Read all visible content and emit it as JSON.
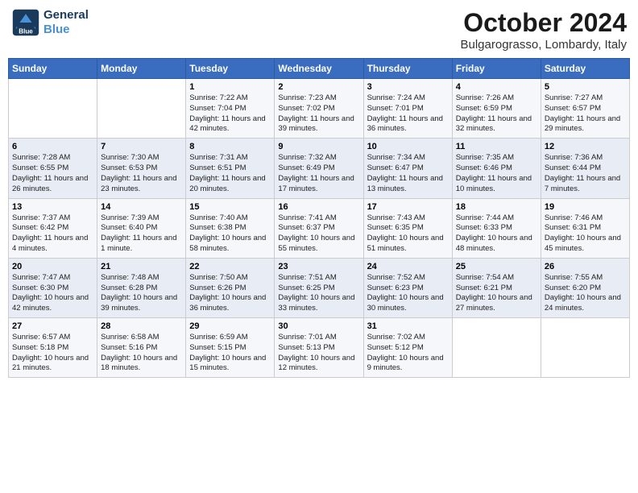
{
  "header": {
    "logo_line1": "General",
    "logo_line2": "Blue",
    "month": "October 2024",
    "location": "Bulgarograsso, Lombardy, Italy"
  },
  "weekdays": [
    "Sunday",
    "Monday",
    "Tuesday",
    "Wednesday",
    "Thursday",
    "Friday",
    "Saturday"
  ],
  "weeks": [
    [
      {
        "day": "",
        "sunrise": "",
        "sunset": "",
        "daylight": ""
      },
      {
        "day": "",
        "sunrise": "",
        "sunset": "",
        "daylight": ""
      },
      {
        "day": "1",
        "sunrise": "Sunrise: 7:22 AM",
        "sunset": "Sunset: 7:04 PM",
        "daylight": "Daylight: 11 hours and 42 minutes."
      },
      {
        "day": "2",
        "sunrise": "Sunrise: 7:23 AM",
        "sunset": "Sunset: 7:02 PM",
        "daylight": "Daylight: 11 hours and 39 minutes."
      },
      {
        "day": "3",
        "sunrise": "Sunrise: 7:24 AM",
        "sunset": "Sunset: 7:01 PM",
        "daylight": "Daylight: 11 hours and 36 minutes."
      },
      {
        "day": "4",
        "sunrise": "Sunrise: 7:26 AM",
        "sunset": "Sunset: 6:59 PM",
        "daylight": "Daylight: 11 hours and 32 minutes."
      },
      {
        "day": "5",
        "sunrise": "Sunrise: 7:27 AM",
        "sunset": "Sunset: 6:57 PM",
        "daylight": "Daylight: 11 hours and 29 minutes."
      }
    ],
    [
      {
        "day": "6",
        "sunrise": "Sunrise: 7:28 AM",
        "sunset": "Sunset: 6:55 PM",
        "daylight": "Daylight: 11 hours and 26 minutes."
      },
      {
        "day": "7",
        "sunrise": "Sunrise: 7:30 AM",
        "sunset": "Sunset: 6:53 PM",
        "daylight": "Daylight: 11 hours and 23 minutes."
      },
      {
        "day": "8",
        "sunrise": "Sunrise: 7:31 AM",
        "sunset": "Sunset: 6:51 PM",
        "daylight": "Daylight: 11 hours and 20 minutes."
      },
      {
        "day": "9",
        "sunrise": "Sunrise: 7:32 AM",
        "sunset": "Sunset: 6:49 PM",
        "daylight": "Daylight: 11 hours and 17 minutes."
      },
      {
        "day": "10",
        "sunrise": "Sunrise: 7:34 AM",
        "sunset": "Sunset: 6:47 PM",
        "daylight": "Daylight: 11 hours and 13 minutes."
      },
      {
        "day": "11",
        "sunrise": "Sunrise: 7:35 AM",
        "sunset": "Sunset: 6:46 PM",
        "daylight": "Daylight: 11 hours and 10 minutes."
      },
      {
        "day": "12",
        "sunrise": "Sunrise: 7:36 AM",
        "sunset": "Sunset: 6:44 PM",
        "daylight": "Daylight: 11 hours and 7 minutes."
      }
    ],
    [
      {
        "day": "13",
        "sunrise": "Sunrise: 7:37 AM",
        "sunset": "Sunset: 6:42 PM",
        "daylight": "Daylight: 11 hours and 4 minutes."
      },
      {
        "day": "14",
        "sunrise": "Sunrise: 7:39 AM",
        "sunset": "Sunset: 6:40 PM",
        "daylight": "Daylight: 11 hours and 1 minute."
      },
      {
        "day": "15",
        "sunrise": "Sunrise: 7:40 AM",
        "sunset": "Sunset: 6:38 PM",
        "daylight": "Daylight: 10 hours and 58 minutes."
      },
      {
        "day": "16",
        "sunrise": "Sunrise: 7:41 AM",
        "sunset": "Sunset: 6:37 PM",
        "daylight": "Daylight: 10 hours and 55 minutes."
      },
      {
        "day": "17",
        "sunrise": "Sunrise: 7:43 AM",
        "sunset": "Sunset: 6:35 PM",
        "daylight": "Daylight: 10 hours and 51 minutes."
      },
      {
        "day": "18",
        "sunrise": "Sunrise: 7:44 AM",
        "sunset": "Sunset: 6:33 PM",
        "daylight": "Daylight: 10 hours and 48 minutes."
      },
      {
        "day": "19",
        "sunrise": "Sunrise: 7:46 AM",
        "sunset": "Sunset: 6:31 PM",
        "daylight": "Daylight: 10 hours and 45 minutes."
      }
    ],
    [
      {
        "day": "20",
        "sunrise": "Sunrise: 7:47 AM",
        "sunset": "Sunset: 6:30 PM",
        "daylight": "Daylight: 10 hours and 42 minutes."
      },
      {
        "day": "21",
        "sunrise": "Sunrise: 7:48 AM",
        "sunset": "Sunset: 6:28 PM",
        "daylight": "Daylight: 10 hours and 39 minutes."
      },
      {
        "day": "22",
        "sunrise": "Sunrise: 7:50 AM",
        "sunset": "Sunset: 6:26 PM",
        "daylight": "Daylight: 10 hours and 36 minutes."
      },
      {
        "day": "23",
        "sunrise": "Sunrise: 7:51 AM",
        "sunset": "Sunset: 6:25 PM",
        "daylight": "Daylight: 10 hours and 33 minutes."
      },
      {
        "day": "24",
        "sunrise": "Sunrise: 7:52 AM",
        "sunset": "Sunset: 6:23 PM",
        "daylight": "Daylight: 10 hours and 30 minutes."
      },
      {
        "day": "25",
        "sunrise": "Sunrise: 7:54 AM",
        "sunset": "Sunset: 6:21 PM",
        "daylight": "Daylight: 10 hours and 27 minutes."
      },
      {
        "day": "26",
        "sunrise": "Sunrise: 7:55 AM",
        "sunset": "Sunset: 6:20 PM",
        "daylight": "Daylight: 10 hours and 24 minutes."
      }
    ],
    [
      {
        "day": "27",
        "sunrise": "Sunrise: 6:57 AM",
        "sunset": "Sunset: 5:18 PM",
        "daylight": "Daylight: 10 hours and 21 minutes."
      },
      {
        "day": "28",
        "sunrise": "Sunrise: 6:58 AM",
        "sunset": "Sunset: 5:16 PM",
        "daylight": "Daylight: 10 hours and 18 minutes."
      },
      {
        "day": "29",
        "sunrise": "Sunrise: 6:59 AM",
        "sunset": "Sunset: 5:15 PM",
        "daylight": "Daylight: 10 hours and 15 minutes."
      },
      {
        "day": "30",
        "sunrise": "Sunrise: 7:01 AM",
        "sunset": "Sunset: 5:13 PM",
        "daylight": "Daylight: 10 hours and 12 minutes."
      },
      {
        "day": "31",
        "sunrise": "Sunrise: 7:02 AM",
        "sunset": "Sunset: 5:12 PM",
        "daylight": "Daylight: 10 hours and 9 minutes."
      },
      {
        "day": "",
        "sunrise": "",
        "sunset": "",
        "daylight": ""
      },
      {
        "day": "",
        "sunrise": "",
        "sunset": "",
        "daylight": ""
      }
    ]
  ]
}
